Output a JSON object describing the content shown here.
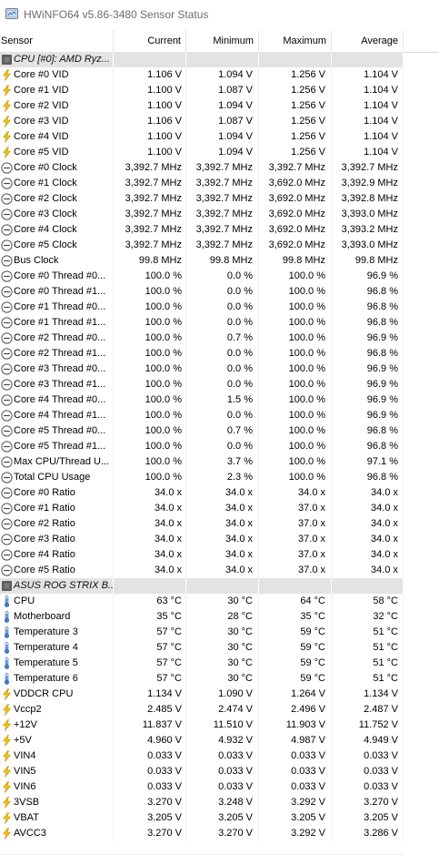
{
  "window": {
    "title": "HWiNFO64 v5.86-3480 Sensor Status"
  },
  "columns": {
    "sensor": "Sensor",
    "current": "Current",
    "minimum": "Minimum",
    "maximum": "Maximum",
    "average": "Average"
  },
  "rows": [
    {
      "type": "group",
      "icon": "chip-icon",
      "label": "CPU [#0]: AMD Ryz..."
    },
    {
      "icon": "voltage-icon",
      "label": "Core #0 VID",
      "current": "1.106 V",
      "minimum": "1.094 V",
      "maximum": "1.256 V",
      "average": "1.104 V"
    },
    {
      "icon": "voltage-icon",
      "label": "Core #1 VID",
      "current": "1.100 V",
      "minimum": "1.087 V",
      "maximum": "1.256 V",
      "average": "1.104 V"
    },
    {
      "icon": "voltage-icon",
      "label": "Core #2 VID",
      "current": "1.100 V",
      "minimum": "1.094 V",
      "maximum": "1.256 V",
      "average": "1.104 V"
    },
    {
      "icon": "voltage-icon",
      "label": "Core #3 VID",
      "current": "1.106 V",
      "minimum": "1.087 V",
      "maximum": "1.256 V",
      "average": "1.104 V"
    },
    {
      "icon": "voltage-icon",
      "label": "Core #4 VID",
      "current": "1.100 V",
      "minimum": "1.094 V",
      "maximum": "1.256 V",
      "average": "1.104 V"
    },
    {
      "icon": "voltage-icon",
      "label": "Core #5 VID",
      "current": "1.100 V",
      "minimum": "1.094 V",
      "maximum": "1.256 V",
      "average": "1.104 V"
    },
    {
      "icon": "clock-icon",
      "label": "Core #0 Clock",
      "current": "3,392.7 MHz",
      "minimum": "3,392.7 MHz",
      "maximum": "3,392.7 MHz",
      "average": "3,392.7 MHz"
    },
    {
      "icon": "clock-icon",
      "label": "Core #1 Clock",
      "current": "3,392.7 MHz",
      "minimum": "3,392.7 MHz",
      "maximum": "3,692.0 MHz",
      "average": "3,392.9 MHz"
    },
    {
      "icon": "clock-icon",
      "label": "Core #2 Clock",
      "current": "3,392.7 MHz",
      "minimum": "3,392.7 MHz",
      "maximum": "3,692.0 MHz",
      "average": "3,392.8 MHz"
    },
    {
      "icon": "clock-icon",
      "label": "Core #3 Clock",
      "current": "3,392.7 MHz",
      "minimum": "3,392.7 MHz",
      "maximum": "3,692.0 MHz",
      "average": "3,393.0 MHz"
    },
    {
      "icon": "clock-icon",
      "label": "Core #4 Clock",
      "current": "3,392.7 MHz",
      "minimum": "3,392.7 MHz",
      "maximum": "3,692.0 MHz",
      "average": "3,393.2 MHz"
    },
    {
      "icon": "clock-icon",
      "label": "Core #5 Clock",
      "current": "3,392.7 MHz",
      "minimum": "3,392.7 MHz",
      "maximum": "3,692.0 MHz",
      "average": "3,393.0 MHz"
    },
    {
      "icon": "clock-icon",
      "label": "Bus Clock",
      "current": "99.8 MHz",
      "minimum": "99.8 MHz",
      "maximum": "99.8 MHz",
      "average": "99.8 MHz"
    },
    {
      "icon": "clock-icon",
      "label": "Core #0 Thread #0...",
      "current": "100.0 %",
      "minimum": "0.0 %",
      "maximum": "100.0 %",
      "average": "96.9 %"
    },
    {
      "icon": "clock-icon",
      "label": "Core #0 Thread #1...",
      "current": "100.0 %",
      "minimum": "0.0 %",
      "maximum": "100.0 %",
      "average": "96.8 %"
    },
    {
      "icon": "clock-icon",
      "label": "Core #1 Thread #0...",
      "current": "100.0 %",
      "minimum": "0.0 %",
      "maximum": "100.0 %",
      "average": "96.8 %"
    },
    {
      "icon": "clock-icon",
      "label": "Core #1 Thread #1...",
      "current": "100.0 %",
      "minimum": "0.0 %",
      "maximum": "100.0 %",
      "average": "96.8 %"
    },
    {
      "icon": "clock-icon",
      "label": "Core #2 Thread #0...",
      "current": "100.0 %",
      "minimum": "0.7 %",
      "maximum": "100.0 %",
      "average": "96.9 %"
    },
    {
      "icon": "clock-icon",
      "label": "Core #2 Thread #1...",
      "current": "100.0 %",
      "minimum": "0.0 %",
      "maximum": "100.0 %",
      "average": "96.8 %"
    },
    {
      "icon": "clock-icon",
      "label": "Core #3 Thread #0...",
      "current": "100.0 %",
      "minimum": "0.0 %",
      "maximum": "100.0 %",
      "average": "96.9 %"
    },
    {
      "icon": "clock-icon",
      "label": "Core #3 Thread #1...",
      "current": "100.0 %",
      "minimum": "0.0 %",
      "maximum": "100.0 %",
      "average": "96.9 %"
    },
    {
      "icon": "clock-icon",
      "label": "Core #4 Thread #0...",
      "current": "100.0 %",
      "minimum": "1.5 %",
      "maximum": "100.0 %",
      "average": "96.9 %"
    },
    {
      "icon": "clock-icon",
      "label": "Core #4 Thread #1...",
      "current": "100.0 %",
      "minimum": "0.0 %",
      "maximum": "100.0 %",
      "average": "96.9 %"
    },
    {
      "icon": "clock-icon",
      "label": "Core #5 Thread #0...",
      "current": "100.0 %",
      "minimum": "0.7 %",
      "maximum": "100.0 %",
      "average": "96.8 %"
    },
    {
      "icon": "clock-icon",
      "label": "Core #5 Thread #1...",
      "current": "100.0 %",
      "minimum": "0.0 %",
      "maximum": "100.0 %",
      "average": "96.8 %"
    },
    {
      "icon": "clock-icon",
      "label": "Max CPU/Thread U...",
      "current": "100.0 %",
      "minimum": "3.7 %",
      "maximum": "100.0 %",
      "average": "97.1 %"
    },
    {
      "icon": "clock-icon",
      "label": "Total CPU Usage",
      "current": "100.0 %",
      "minimum": "2.3 %",
      "maximum": "100.0 %",
      "average": "96.8 %"
    },
    {
      "icon": "clock-icon",
      "label": "Core #0 Ratio",
      "current": "34.0 x",
      "minimum": "34.0 x",
      "maximum": "34.0 x",
      "average": "34.0 x"
    },
    {
      "icon": "clock-icon",
      "label": "Core #1 Ratio",
      "current": "34.0 x",
      "minimum": "34.0 x",
      "maximum": "37.0 x",
      "average": "34.0 x"
    },
    {
      "icon": "clock-icon",
      "label": "Core #2 Ratio",
      "current": "34.0 x",
      "minimum": "34.0 x",
      "maximum": "37.0 x",
      "average": "34.0 x"
    },
    {
      "icon": "clock-icon",
      "label": "Core #3 Ratio",
      "current": "34.0 x",
      "minimum": "34.0 x",
      "maximum": "37.0 x",
      "average": "34.0 x"
    },
    {
      "icon": "clock-icon",
      "label": "Core #4 Ratio",
      "current": "34.0 x",
      "minimum": "34.0 x",
      "maximum": "37.0 x",
      "average": "34.0 x"
    },
    {
      "icon": "clock-icon",
      "label": "Core #5 Ratio",
      "current": "34.0 x",
      "minimum": "34.0 x",
      "maximum": "37.0 x",
      "average": "34.0 x"
    },
    {
      "type": "group",
      "icon": "chip-icon",
      "label": "ASUS ROG STRIX B..."
    },
    {
      "icon": "thermometer-icon",
      "label": "CPU",
      "current": "63 °C",
      "minimum": "30 °C",
      "maximum": "64 °C",
      "average": "58 °C"
    },
    {
      "icon": "thermometer-icon",
      "label": "Motherboard",
      "current": "35 °C",
      "minimum": "28 °C",
      "maximum": "35 °C",
      "average": "32 °C"
    },
    {
      "icon": "thermometer-icon",
      "label": "Temperature 3",
      "current": "57 °C",
      "minimum": "30 °C",
      "maximum": "59 °C",
      "average": "51 °C"
    },
    {
      "icon": "thermometer-icon",
      "label": "Temperature 4",
      "current": "57 °C",
      "minimum": "30 °C",
      "maximum": "59 °C",
      "average": "51 °C"
    },
    {
      "icon": "thermometer-icon",
      "label": "Temperature 5",
      "current": "57 °C",
      "minimum": "30 °C",
      "maximum": "59 °C",
      "average": "51 °C"
    },
    {
      "icon": "thermometer-icon",
      "label": "Temperature 6",
      "current": "57 °C",
      "minimum": "30 °C",
      "maximum": "59 °C",
      "average": "51 °C"
    },
    {
      "icon": "voltage-icon",
      "label": "VDDCR CPU",
      "current": "1.134 V",
      "minimum": "1.090 V",
      "maximum": "1.264 V",
      "average": "1.134 V"
    },
    {
      "icon": "voltage-icon",
      "label": "Vccp2",
      "current": "2.485 V",
      "minimum": "2.474 V",
      "maximum": "2.496 V",
      "average": "2.487 V"
    },
    {
      "icon": "voltage-icon",
      "label": "+12V",
      "current": "11.837 V",
      "minimum": "11.510 V",
      "maximum": "11.903 V",
      "average": "11.752 V"
    },
    {
      "icon": "voltage-icon",
      "label": "+5V",
      "current": "4.960 V",
      "minimum": "4.932 V",
      "maximum": "4.987 V",
      "average": "4.949 V"
    },
    {
      "icon": "voltage-icon",
      "label": "VIN4",
      "current": "0.033 V",
      "minimum": "0.033 V",
      "maximum": "0.033 V",
      "average": "0.033 V"
    },
    {
      "icon": "voltage-icon",
      "label": "VIN5",
      "current": "0.033 V",
      "minimum": "0.033 V",
      "maximum": "0.033 V",
      "average": "0.033 V"
    },
    {
      "icon": "voltage-icon",
      "label": "VIN6",
      "current": "0.033 V",
      "minimum": "0.033 V",
      "maximum": "0.033 V",
      "average": "0.033 V"
    },
    {
      "icon": "voltage-icon",
      "label": "3VSB",
      "current": "3.270 V",
      "minimum": "3.248 V",
      "maximum": "3.292 V",
      "average": "3.270 V"
    },
    {
      "icon": "voltage-icon",
      "label": "VBAT",
      "current": "3.205 V",
      "minimum": "3.205 V",
      "maximum": "3.205 V",
      "average": "3.205 V"
    },
    {
      "icon": "voltage-icon",
      "label": "AVCC3",
      "current": "3.270 V",
      "minimum": "3.270 V",
      "maximum": "3.292 V",
      "average": "3.286 V"
    }
  ]
}
